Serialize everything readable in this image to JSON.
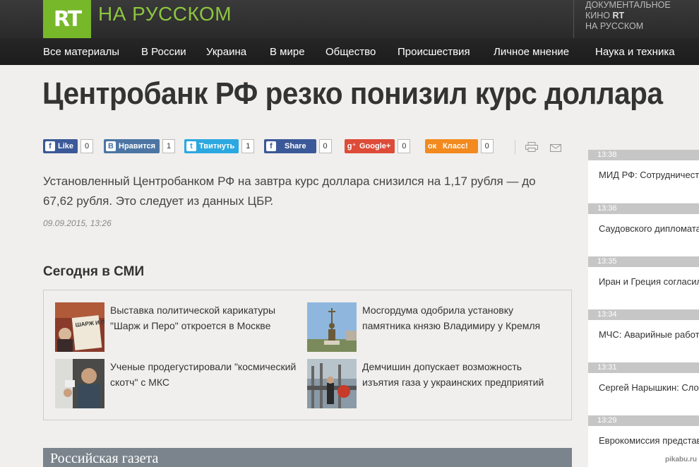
{
  "header": {
    "logo": "RT",
    "site_name": "НА РУССКОМ",
    "doc_line1": "ДОКУМЕНТАЛЬНОЕ",
    "doc_line2_prefix": "КИНО ",
    "doc_line2_rt": "RT",
    "doc_line3": "НА РУССКОМ"
  },
  "nav": {
    "items": [
      {
        "label": "Все материалы"
      },
      {
        "label": "В России"
      },
      {
        "label": "Украина"
      },
      {
        "label": "В мире"
      },
      {
        "label": "Общество"
      },
      {
        "label": "Происшествия"
      },
      {
        "label": "Личное мнение"
      },
      {
        "label": "Наука и техника"
      }
    ]
  },
  "article": {
    "title": "Центробанк РФ резко понизил курс доллара",
    "lead": "Установленный Центробанком РФ на завтра курс доллара снизился на 1,17 рубля — до 67,62 рубля. Это следует из данных ЦБР.",
    "date": "09.09.2015, 13:26"
  },
  "share": {
    "facebook_like": {
      "label": "Like",
      "count": "0",
      "color": "#3b5998"
    },
    "vk": {
      "label": "Нравится",
      "count": "1",
      "color": "#4c75a3"
    },
    "twitter": {
      "label": "Твитнуть",
      "count": "1",
      "color": "#2ca8e0"
    },
    "facebook_share": {
      "label": "Share",
      "count": "0",
      "color": "#3b5998"
    },
    "google": {
      "label": "Google+",
      "count": "0",
      "color": "#dd4b39"
    },
    "ok": {
      "label": "Класс!",
      "count": "0",
      "color": "#f28a1f"
    }
  },
  "smi": {
    "title": "Сегодня в СМИ",
    "items": [
      {
        "text": "Выставка политической карикатуры \"Шарж и Перо\" откроется в Москве",
        "thumb_label": "ШАРЖ И ПЕРО"
      },
      {
        "text": "Мосгордума одобрила установку памятника князю Владимиру у Кремля"
      },
      {
        "text": "Ученые продегустировали \"космический скотч\" с МКС"
      },
      {
        "text": "Демчишин допускает возможность изъятия газа у украинских предприятий"
      }
    ]
  },
  "rg": {
    "title": "Российская газета"
  },
  "feed": {
    "items": [
      {
        "time": "13:38",
        "text": "МИД РФ: Сотрудничество по отношениям России и Украины"
      },
      {
        "time": "13:36",
        "text": "Саудовского дипломата в Непала"
      },
      {
        "time": "13:35",
        "text": "Иран и Греция согласились на самолёты с гуманитарной"
      },
      {
        "time": "13:34",
        "text": "МЧС: Аварийные работы в Свердловской области"
      },
      {
        "time": "13:31",
        "text": "Сергей Нарышкин: Слова о непогрешимости приведены"
      },
      {
        "time": "13:29",
        "text": "Еврокомиссия представила мигрантов среди стран"
      }
    ]
  },
  "watermark": "pikabu.ru"
}
